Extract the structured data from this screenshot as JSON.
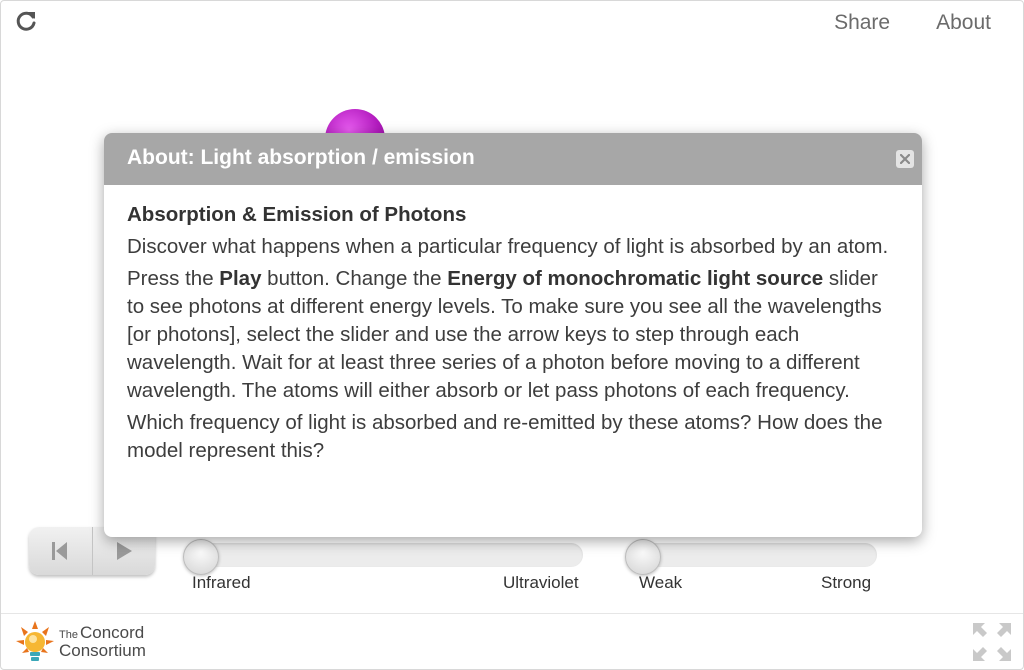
{
  "topbar": {
    "reload_icon": "reload-icon",
    "share_label": "Share",
    "about_label": "About"
  },
  "colors": {
    "dialog_header": "#a7a7a7",
    "atom": "#b21bbe",
    "text": "#3d3d3d"
  },
  "dialog": {
    "title": "About: Light absorption / emission",
    "heading": "Absorption & Emission of Photons",
    "p1": "Discover what happens when a particular frequency of light is absorbed by an atom.",
    "p2_a": "Press the ",
    "p2_play": "Play",
    "p2_b": " button. Change the ",
    "p2_energy": "Energy of monochromatic light source",
    "p2_c": " slider to see photons at different energy levels. To make sure you see all the wavelengths [or photons], select the slider and use the arrow keys to step through each wavelength. Wait for at least three series of a photon before moving to a different wavelength. The atoms will either absorb or let pass photons of each frequency.",
    "p3": "Which frequency of light is absorbed and re-emitted by these atoms? How does the model represent this?"
  },
  "controls": {
    "energy_slider": {
      "min_label": "Infrared",
      "max_label": "Ultraviolet",
      "value": 0
    },
    "intensity_slider": {
      "min_label": "Weak",
      "max_label": "Strong",
      "value": 0
    }
  },
  "footer": {
    "logo_small": "The",
    "logo_line1": "Concord",
    "logo_line2": "Consortium"
  }
}
